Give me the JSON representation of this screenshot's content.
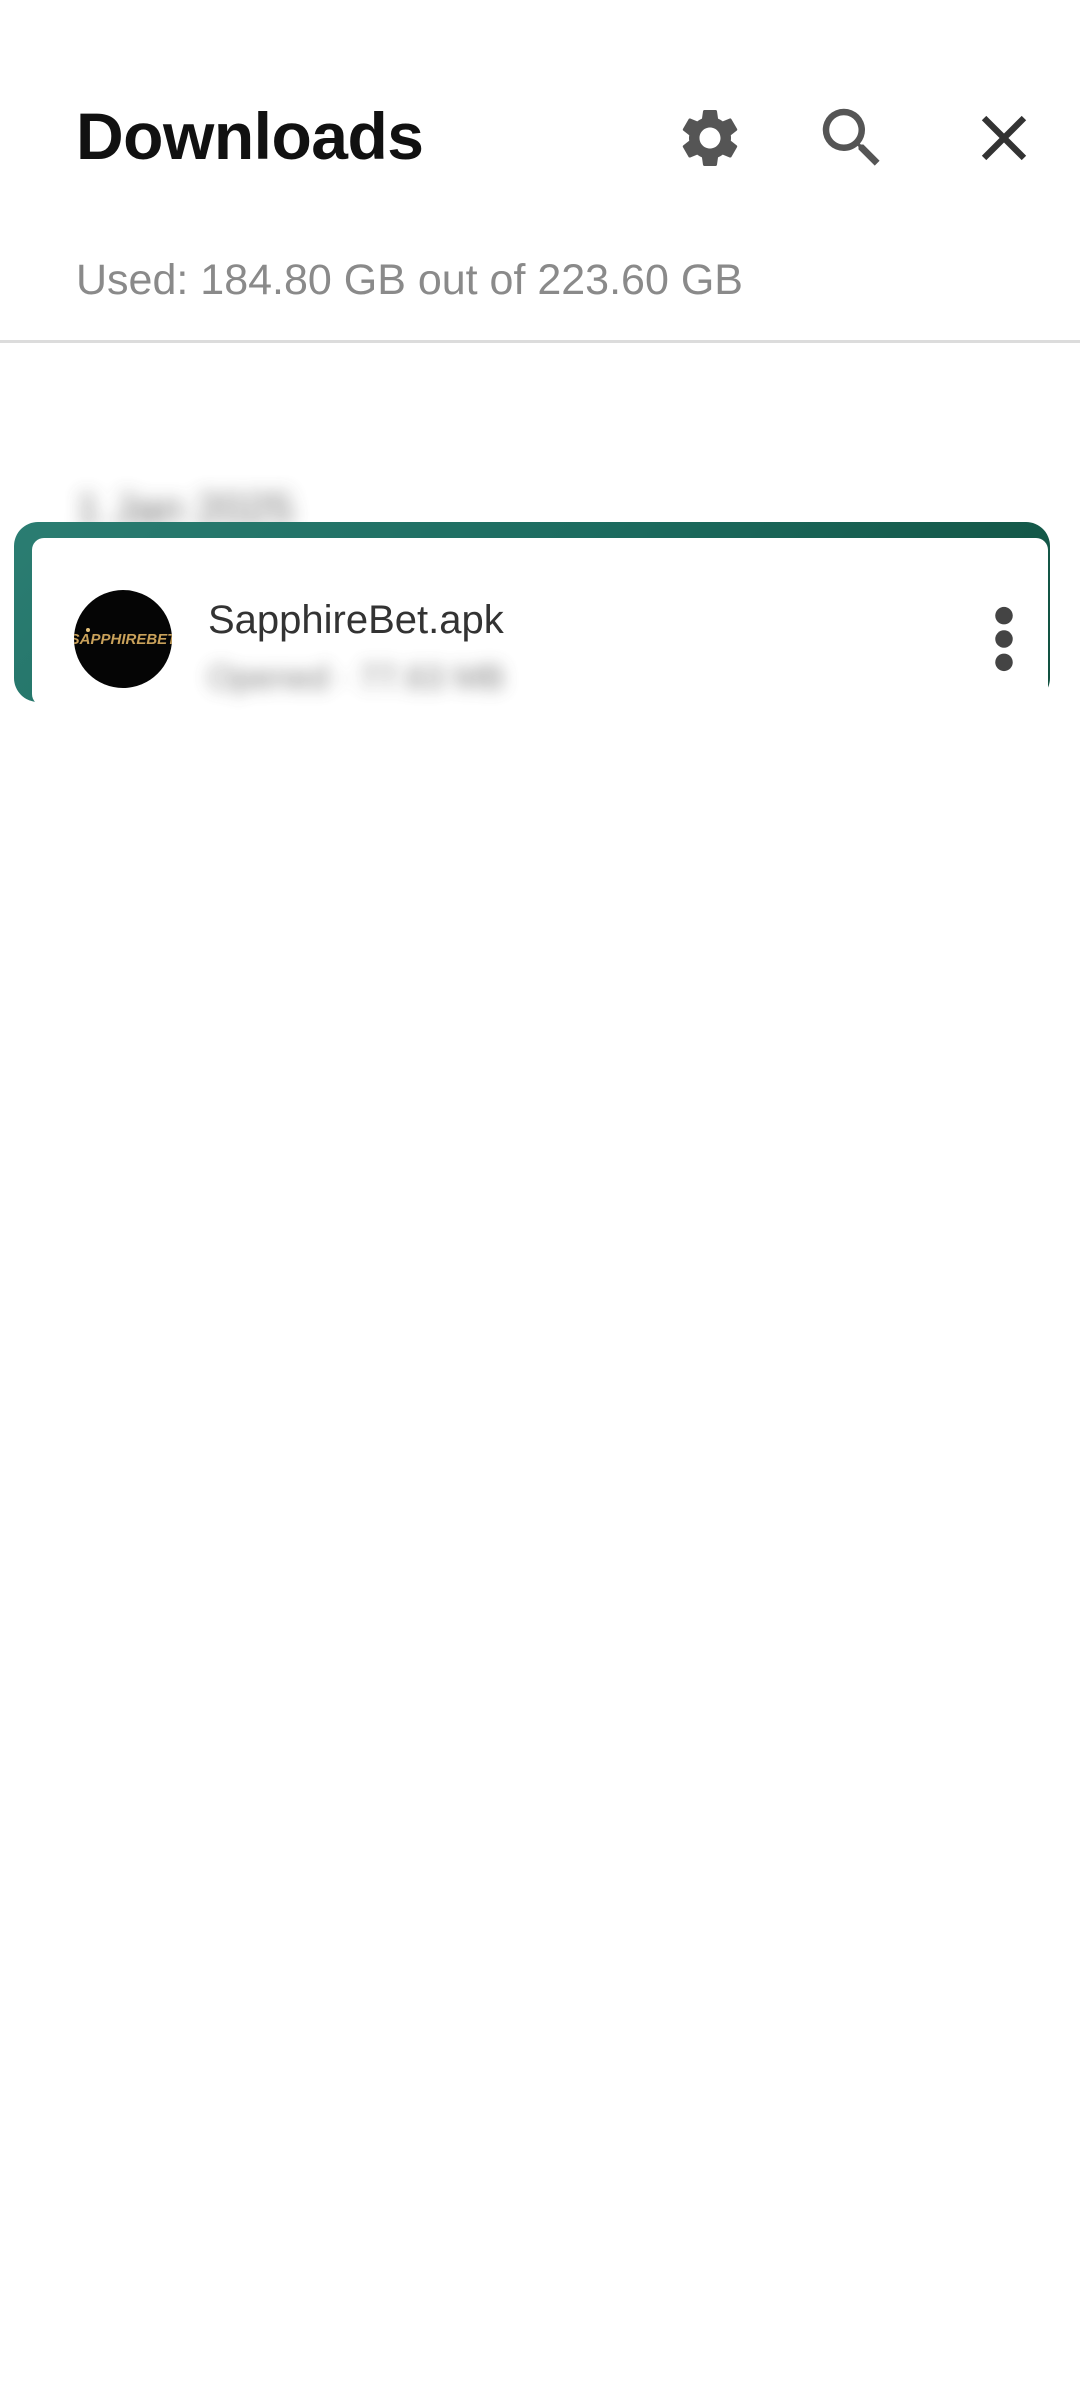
{
  "header": {
    "title": "Downloads",
    "settings_icon": "gear-icon",
    "search_icon": "search-icon",
    "close_icon": "close-icon"
  },
  "storage": {
    "text": "Used: 184.80 GB out of 223.60 GB"
  },
  "downloads": {
    "date_header": "1 Jan 2025",
    "items": [
      {
        "avatar_text": "SAPPHIREBET",
        "file_name": "SapphireBet.apk",
        "meta": "Opened · 77.63 MB",
        "menu_icon": "more-vert-icon"
      }
    ]
  },
  "colors": {
    "highlight_border": "#1c6b5f",
    "icon_gray": "#555555",
    "secondary_text": "#8a8a8a",
    "avatar_bg": "#050505",
    "avatar_logo": "#c9a15a"
  }
}
